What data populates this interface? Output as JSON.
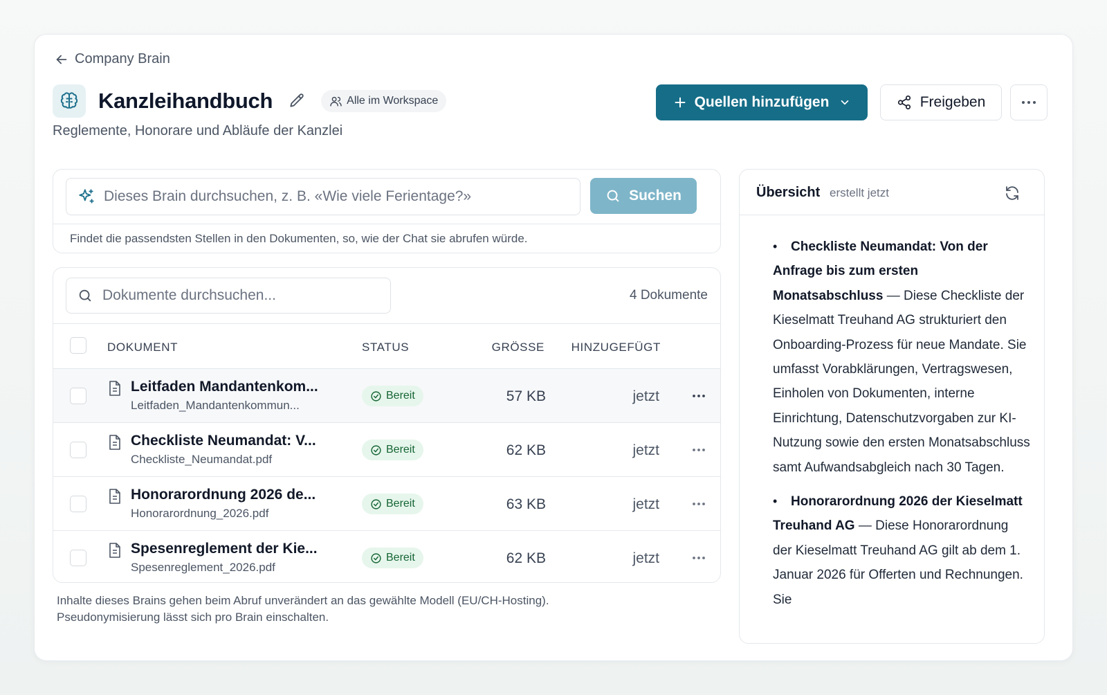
{
  "breadcrumb": {
    "back_label": "Company Brain"
  },
  "header": {
    "title": "Kanzleihandbuch",
    "visibility": "Alle im Workspace",
    "subtitle": "Reglemente, Honorare und Abläufe der Kanzlei",
    "primary_button": "Quellen hinzufügen",
    "share_button": "Freigeben"
  },
  "brain_search": {
    "placeholder": "Dieses Brain durchsuchen, z. B. «Wie viele Ferientage?»",
    "button": "Suchen",
    "hint": "Findet die passendsten Stellen in den Dokumenten, so, wie der Chat sie abrufen würde."
  },
  "documents": {
    "search_placeholder": "Dokumente durchsuchen...",
    "count": "4 Dokumente",
    "columns": {
      "document": "DOKUMENT",
      "status": "STATUS",
      "size": "GRÖSSE",
      "added": "HINZUGEFÜGT"
    },
    "rows": [
      {
        "name": "Leitfaden Mandantenkom...",
        "file": "Leitfaden_Mandantenkommun...",
        "status": "Bereit",
        "size": "57 KB",
        "added": "jetzt"
      },
      {
        "name": "Checkliste Neumandat: V...",
        "file": "Checkliste_Neumandat.pdf",
        "status": "Bereit",
        "size": "62 KB",
        "added": "jetzt"
      },
      {
        "name": "Honorarordnung 2026 de...",
        "file": "Honorarordnung_2026.pdf",
        "status": "Bereit",
        "size": "63 KB",
        "added": "jetzt"
      },
      {
        "name": "Spesenreglement der Kie...",
        "file": "Spesenreglement_2026.pdf",
        "status": "Bereit",
        "size": "62 KB",
        "added": "jetzt"
      }
    ]
  },
  "footnote": {
    "line1": "Inhalte dieses Brains gehen beim Abruf unverändert an das gewählte Modell (EU/CH-Hosting).",
    "line2": "Pseudonymisierung lässt sich pro Brain einschalten."
  },
  "overview": {
    "title": "Übersicht",
    "generated": "erstellt jetzt",
    "items": [
      {
        "title": "Checkliste Neumandat: Von der Anfrage bis zum ersten Monatsabschluss",
        "text": " — Diese Checkliste der Kieselmatt Treuhand AG strukturiert den Onboarding-Prozess für neue Mandate. Sie umfasst Vorabklärungen, Vertragswesen, Einholen von Dokumenten, interne Einrichtung, Datenschutzvorgaben zur KI-Nutzung sowie den ersten Monatsabschluss samt Aufwandsabgleich nach 30 Tagen."
      },
      {
        "title": "Honorarordnung 2026 der Kieselmatt Treuhand AG",
        "text": " — Diese Honorarordnung der Kieselmatt Treuhand AG gilt ab dem 1. Januar 2026 für Offerten und Rechnungen. Sie"
      }
    ]
  },
  "colors": {
    "primary": "#156d87",
    "search_button": "#7fb5c8",
    "status_bg": "#e6f6ec",
    "status_text": "#166534"
  }
}
